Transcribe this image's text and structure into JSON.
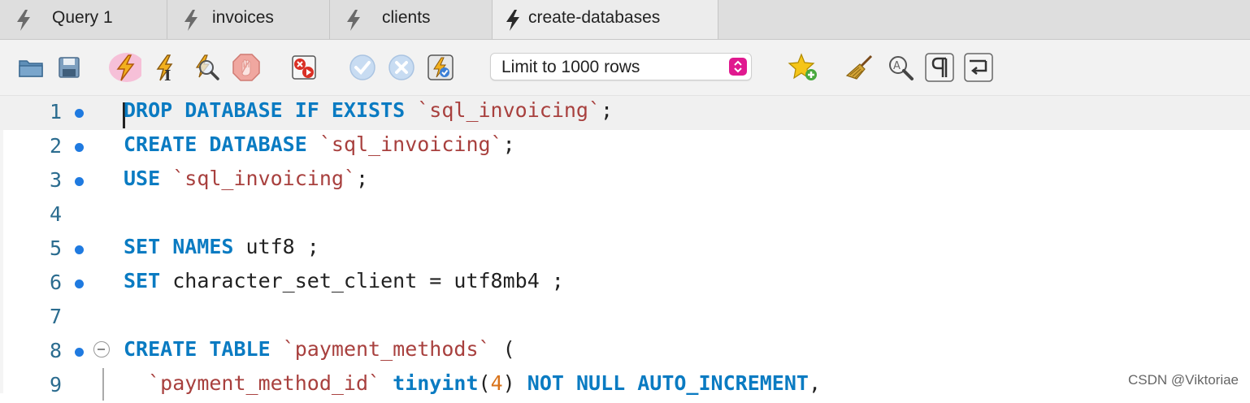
{
  "tabs": [
    {
      "label": "Query 1",
      "active": false
    },
    {
      "label": "invoices",
      "active": false
    },
    {
      "label": "clients",
      "active": false
    },
    {
      "label": "create-databases",
      "active": true
    }
  ],
  "toolbar": {
    "buttons": [
      "open-folder-icon",
      "save-icon",
      "execute-all-icon",
      "execute-current-icon",
      "explain-icon",
      "stop-icon",
      "toggle-error-stop-icon",
      "commit-icon",
      "rollback-icon",
      "autocommit-icon",
      "add-snippet-icon",
      "beautify-icon",
      "find-icon",
      "invisible-chars-icon",
      "wrap-lines-icon"
    ],
    "limit_select": "Limit to 1000 rows",
    "accent": "#e0198f"
  },
  "editor": {
    "lines": [
      {
        "n": "1",
        "dot": true
      },
      {
        "n": "2",
        "dot": true
      },
      {
        "n": "3",
        "dot": true
      },
      {
        "n": "4",
        "dot": false
      },
      {
        "n": "5",
        "dot": true
      },
      {
        "n": "6",
        "dot": true
      },
      {
        "n": "7",
        "dot": false
      },
      {
        "n": "8",
        "dot": true,
        "fold": true
      },
      {
        "n": "9",
        "dot": false
      }
    ],
    "code": {
      "l1": {
        "k1": "DROP DATABASE IF EXISTS",
        "s1": "`sql_invoicing`",
        "p1": ";"
      },
      "l2": {
        "k1": "CREATE DATABASE",
        "s1": "`sql_invoicing`",
        "p1": ";"
      },
      "l3": {
        "k1": "USE",
        "s1": "`sql_invoicing`",
        "p1": ";"
      },
      "l5": {
        "k1": "SET NAMES",
        "t1": "utf8 ;"
      },
      "l6": {
        "k1": "SET",
        "t1": "character_set_client = utf8mb4 ;"
      },
      "l8": {
        "k1": "CREATE TABLE",
        "s1": "`payment_methods`",
        "p1": "("
      },
      "l9": {
        "s1": "`payment_method_id`",
        "k1": "tinyint",
        "p1": "(",
        "n1": "4",
        "p2": ")",
        "k2": "NOT NULL AUTO_INCREMENT",
        "p3": ","
      }
    },
    "colors": {
      "keyword": "#0a7bc2",
      "string": "#a8403e",
      "number": "#d9731a",
      "line_number": "#2b6c8f",
      "marker": "#1f7ae0"
    }
  },
  "watermark": "CSDN @Viktoriae"
}
